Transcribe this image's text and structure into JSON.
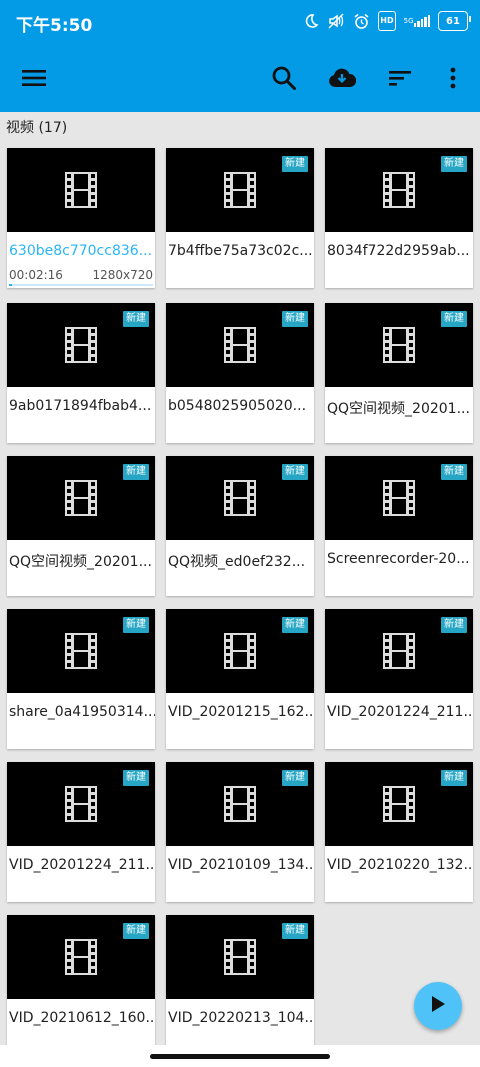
{
  "status_bar": {
    "time": "下午5:50",
    "network_label": "5G",
    "hd_label": "HD",
    "battery": "61",
    "icons": [
      "moon-icon",
      "mute-icon",
      "alarm-icon",
      "hd-icon",
      "signal-icon",
      "battery-icon"
    ]
  },
  "app_bar": {
    "icons": [
      "menu-icon",
      "search-icon",
      "cloud-download-icon",
      "sort-icon",
      "more-vert-icon"
    ]
  },
  "section": {
    "title": "视频 (17)"
  },
  "badge_label": "新建",
  "videos": [
    {
      "title": "630be8c770cc836...",
      "duration": "00:02:16",
      "resolution": "1280x720",
      "progress": 0.02,
      "is_new": false,
      "selected": true
    },
    {
      "title": "7b4ffbe75a73c02c...",
      "is_new": true
    },
    {
      "title": "8034f722d2959ab...",
      "is_new": true
    },
    {
      "title": "9ab0171894fbab4...",
      "is_new": true
    },
    {
      "title": "b0548025905020...",
      "is_new": true
    },
    {
      "title": "QQ空间视频_20201...",
      "is_new": true
    },
    {
      "title": "QQ空间视频_20201...",
      "is_new": true
    },
    {
      "title": "QQ视频_ed0ef232...",
      "is_new": true
    },
    {
      "title": "Screenrecorder-20...",
      "is_new": true
    },
    {
      "title": "share_0a41950314...",
      "is_new": true
    },
    {
      "title": "VID_20201215_162...",
      "is_new": true
    },
    {
      "title": "VID_20201224_211...",
      "is_new": true
    },
    {
      "title": "VID_20201224_211...",
      "is_new": true
    },
    {
      "title": "VID_20210109_134...",
      "is_new": true
    },
    {
      "title": "VID_20210220_132...",
      "is_new": true
    },
    {
      "title": "VID_20210612_160...",
      "is_new": true
    },
    {
      "title": "VID_20220213_104...",
      "is_new": true
    }
  ],
  "fab": {
    "icon": "play-icon"
  },
  "colors": {
    "primary": "#039be5",
    "accent": "#29b6f6",
    "badge": "#26a6c4",
    "fab": "#4fc3f7"
  }
}
